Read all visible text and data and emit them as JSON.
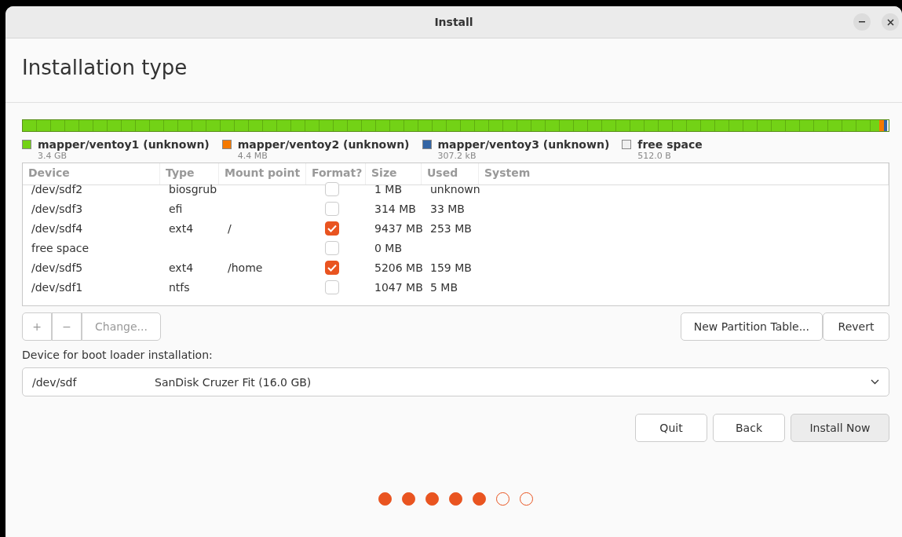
{
  "window": {
    "title": "Install"
  },
  "heading": "Installation type",
  "legend": [
    {
      "name": "mapper/ventoy1 (unknown)",
      "size": "3.4 GB",
      "color": "#73d216"
    },
    {
      "name": "mapper/ventoy2 (unknown)",
      "size": "4.4 MB",
      "color": "#f57900"
    },
    {
      "name": "mapper/ventoy3 (unknown)",
      "size": "307.2 kB",
      "color": "#3465a4"
    },
    {
      "name": "free space",
      "size": "512.0 B",
      "color": "#f0f0f0"
    }
  ],
  "table": {
    "columns": [
      "Device",
      "Type",
      "Mount point",
      "Format?",
      "Size",
      "Used",
      "System"
    ],
    "rows": [
      {
        "device": "/dev/sdf2",
        "type": "biosgrub",
        "mount": "",
        "format": false,
        "size": "1 MB",
        "used": "unknown"
      },
      {
        "device": "/dev/sdf3",
        "type": "efi",
        "mount": "",
        "format": false,
        "size": "314 MB",
        "used": "33 MB"
      },
      {
        "device": "/dev/sdf4",
        "type": "ext4",
        "mount": "/",
        "format": true,
        "size": "9437 MB",
        "used": "253 MB"
      },
      {
        "device": "free space",
        "type": "",
        "mount": "",
        "format": false,
        "size": "0 MB",
        "used": ""
      },
      {
        "device": "/dev/sdf5",
        "type": "ext4",
        "mount": "/home",
        "format": true,
        "size": "5206 MB",
        "used": "159 MB"
      },
      {
        "device": "/dev/sdf1",
        "type": "ntfs",
        "mount": "",
        "format": false,
        "size": "1047 MB",
        "used": "5 MB"
      }
    ]
  },
  "table_buttons": {
    "add": "+",
    "remove": "−",
    "change": "Change...",
    "new_table": "New Partition Table...",
    "revert": "Revert"
  },
  "boot_loader": {
    "label": "Device for boot loader installation:",
    "device": "/dev/sdf",
    "description": "SanDisk Cruzer Fit (16.0 GB)"
  },
  "buttons": [
    "Quit",
    "Back",
    "Install Now"
  ],
  "steps": [
    {
      "done": true
    },
    {
      "done": true
    },
    {
      "done": true
    },
    {
      "done": true
    },
    {
      "done": true
    },
    {
      "done": false
    },
    {
      "done": false
    }
  ]
}
